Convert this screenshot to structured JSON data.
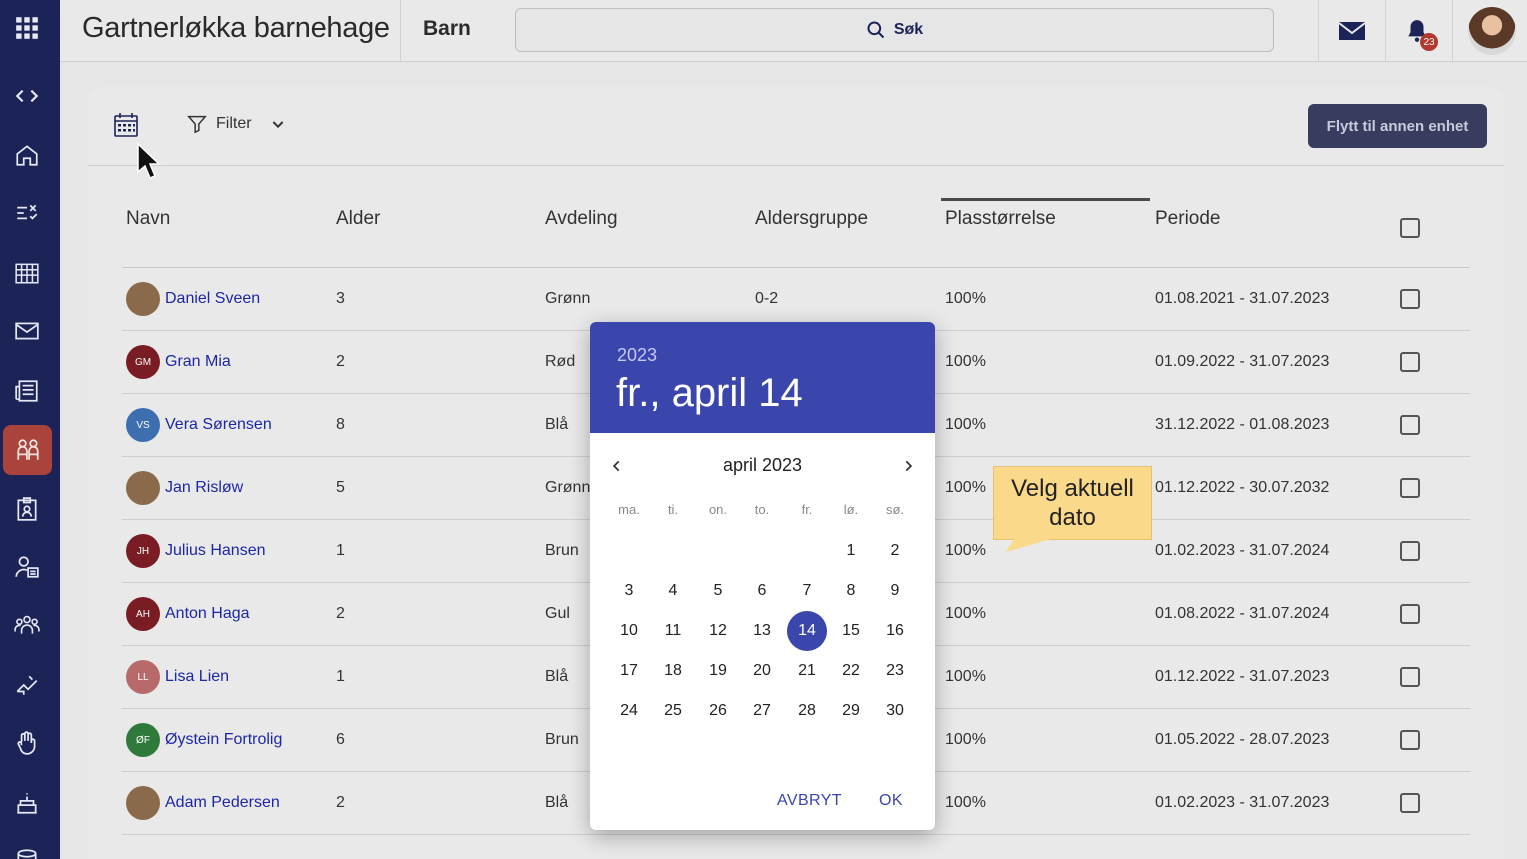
{
  "header": {
    "org_name": "Gartnerløkka barnehage",
    "section": "Barn",
    "search_label": "Søk",
    "notification_count": "23"
  },
  "toolbar": {
    "filter_label": "Filter",
    "move_button": "Flytt til annen enhet"
  },
  "table": {
    "columns": [
      "Navn",
      "Alder",
      "Avdeling",
      "Aldersgruppe",
      "Plasstørrelse",
      "Periode"
    ],
    "rows": [
      {
        "initials": "",
        "name": "Daniel Sveen",
        "age": "3",
        "dept": "Grønn",
        "group": "0-2",
        "size": "100%",
        "period": "01.08.2021 - 31.07.2023"
      },
      {
        "initials": "GM",
        "name": "Gran Mia",
        "age": "2",
        "dept": "Rød",
        "group": "",
        "size": "100%",
        "period": "01.09.2022 - 31.07.2023"
      },
      {
        "initials": "VS",
        "name": "Vera Sørensen",
        "age": "8",
        "dept": "Blå",
        "group": "",
        "size": "100%",
        "period": "31.12.2022 - 01.08.2023"
      },
      {
        "initials": "",
        "name": "Jan Risløw",
        "age": "5",
        "dept": "Grønn",
        "group": "",
        "size": "100%",
        "period": "01.12.2022 - 30.07.2032"
      },
      {
        "initials": "JH",
        "name": "Julius Hansen",
        "age": "1",
        "dept": "Brun",
        "group": "",
        "size": "100%",
        "period": "01.02.2023 - 31.07.2024"
      },
      {
        "initials": "AH",
        "name": "Anton Haga",
        "age": "2",
        "dept": "Gul",
        "group": "",
        "size": "100%",
        "period": "01.08.2022 - 31.07.2024"
      },
      {
        "initials": "LL",
        "name": "Lisa Lien",
        "age": "1",
        "dept": "Blå",
        "group": "",
        "size": "100%",
        "period": "01.12.2022 - 31.07.2023"
      },
      {
        "initials": "ØF",
        "name": "Øystein Fortrolig",
        "age": "6",
        "dept": "Brun",
        "group": "",
        "size": "100%",
        "period": "01.05.2022 - 28.07.2023"
      },
      {
        "initials": "",
        "name": "Adam Pedersen",
        "age": "2",
        "dept": "Blå",
        "group": "",
        "size": "100%",
        "period": "01.02.2023 - 31.07.2023"
      }
    ]
  },
  "picker": {
    "year": "2023",
    "selected_label": "fr., april 14",
    "month_label": "april 2023",
    "weekdays": [
      "ma.",
      "ti.",
      "on.",
      "to.",
      "fr.",
      "lø.",
      "sø."
    ],
    "days": [
      "1",
      "2",
      "3",
      "4",
      "5",
      "6",
      "7",
      "8",
      "9",
      "10",
      "11",
      "12",
      "13",
      "14",
      "15",
      "16",
      "17",
      "18",
      "19",
      "20",
      "21",
      "22",
      "23",
      "24",
      "25",
      "26",
      "27",
      "28",
      "29",
      "30"
    ],
    "selected_day": "14",
    "cancel_label": "AVBRYT",
    "ok_label": "OK"
  },
  "callout": {
    "text_line1": "Velg aktuell",
    "text_line2": "dato"
  },
  "colors": {
    "sidebar": "#1b2357",
    "sidebar_active": "#a9433b",
    "primary": "#3a46ac",
    "link": "#1c27a8",
    "callout": "#fbd98a"
  }
}
